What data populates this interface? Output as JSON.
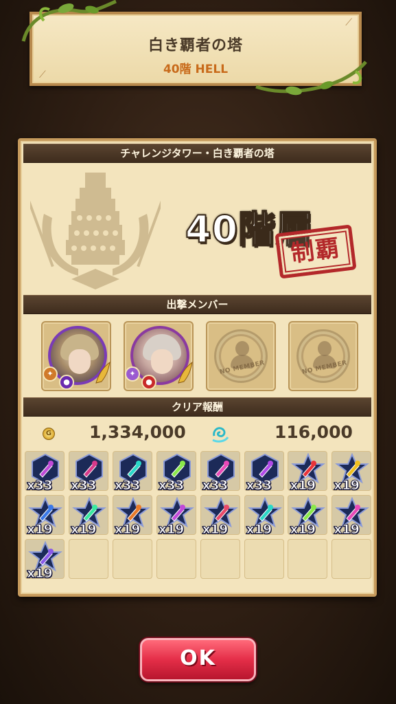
{
  "header": {
    "title": "白き覇者の塔",
    "subtitle": "40階 HELL"
  },
  "panel": {
    "section_title": "チャレンジタワー・白き覇者の塔",
    "floor_label": "40階層",
    "cleared_stamp": "制覇",
    "members_title": "出撃メンバー",
    "members": [
      {
        "type": "character",
        "name": "character-1"
      },
      {
        "type": "character",
        "name": "character-2"
      },
      {
        "type": "empty",
        "label": "NO MEMBER"
      },
      {
        "type": "empty",
        "label": "NO MEMBER"
      }
    ],
    "rewards_title": "クリア報酬",
    "gold_icon": "coin-icon",
    "gold": "1,334,000",
    "exp_icon": "soul-exp-icon",
    "exp": "116,000",
    "items": [
      {
        "icon": "wand-orb",
        "color": "#c04ad8",
        "count": "x33"
      },
      {
        "icon": "sword-orb",
        "color": "#d83a8a",
        "count": "x33"
      },
      {
        "icon": "bow-orb",
        "color": "#2ad8c8",
        "count": "x33"
      },
      {
        "icon": "armor-orb",
        "color": "#8ae84a",
        "count": "x33"
      },
      {
        "icon": "gun-orb",
        "color": "#e84ab8",
        "count": "x33"
      },
      {
        "icon": "staff-orb",
        "color": "#b04ae8",
        "count": "x33"
      },
      {
        "icon": "sword-star",
        "color": "#e8343a",
        "count": "x19"
      },
      {
        "icon": "hand-star",
        "color": "#f0c020",
        "count": "x19"
      },
      {
        "icon": "spear-star",
        "color": "#3a78e8",
        "count": "x19"
      },
      {
        "icon": "bow-star",
        "color": "#3ae8a0",
        "count": "x19"
      },
      {
        "icon": "crossbow-star",
        "color": "#e87a2a",
        "count": "x19"
      },
      {
        "icon": "wand-star",
        "color": "#c04ad8",
        "count": "x19"
      },
      {
        "icon": "blade-star",
        "color": "#e84a6a",
        "count": "x19"
      },
      {
        "icon": "gem-star",
        "color": "#2ad8c8",
        "count": "x19"
      },
      {
        "icon": "armor-star",
        "color": "#8ae84a",
        "count": "x19"
      },
      {
        "icon": "gun-star",
        "color": "#e84ab8",
        "count": "x19"
      },
      {
        "icon": "scepter-star",
        "color": "#8a5ae8",
        "count": "x19"
      }
    ],
    "empty_slots": 7
  },
  "ok_button": {
    "label": "OK"
  }
}
